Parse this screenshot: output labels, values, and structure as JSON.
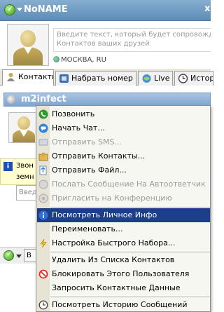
{
  "user": {
    "name": "NoNAME",
    "status_icon": "online-check-icon"
  },
  "profile": {
    "mood_placeholder": "Введите текст, который будет сопровождать",
    "mood_placeholder_line2": "Контактов ваших друзей",
    "location": "МОСКВА, RU"
  },
  "tabs": [
    {
      "label": "Контакты",
      "icon": "contacts-icon",
      "active": true
    },
    {
      "label": "Набрать номер",
      "icon": "dialpad-icon",
      "active": false
    },
    {
      "label": "Live",
      "icon": "live-icon",
      "active": false
    },
    {
      "label": "Истор",
      "icon": "history-icon",
      "active": false
    }
  ],
  "contact": {
    "name": "m2infect"
  },
  "notice": {
    "line1": "Звон",
    "line2": "земн"
  },
  "search": {
    "placeholder": "Введ"
  },
  "bottom": {
    "button_label": "В"
  },
  "menu": [
    {
      "label": "Позвонить",
      "icon": "phone-icon",
      "disabled": false
    },
    {
      "label": "Начать Чат...",
      "icon": "chat-icon",
      "disabled": false
    },
    {
      "label": "Отправить SMS...",
      "icon": "sms-icon",
      "disabled": true
    },
    {
      "label": "Отправить Контакты...",
      "icon": "send-contacts-icon",
      "disabled": false
    },
    {
      "label": "Отправить Файл...",
      "icon": "send-file-icon",
      "disabled": false
    },
    {
      "label": "Послать Сообщение На Автоответчик",
      "icon": "voicemail-icon",
      "disabled": true
    },
    {
      "label": "Пригласить на Конференцию",
      "icon": "conference-icon",
      "disabled": true
    },
    {
      "label": "Посмотреть Личное Инфо",
      "icon": "info-icon",
      "disabled": false,
      "selected": true
    },
    {
      "label": "Переименовать...",
      "icon": "",
      "disabled": false
    },
    {
      "label": "Настройка Быстрого Набора...",
      "icon": "speed-dial-icon",
      "disabled": false
    },
    {
      "label": "Удалить Из Списка Контактов",
      "icon": "",
      "disabled": false
    },
    {
      "label": "Блокировать Этого Пользователя",
      "icon": "block-icon",
      "disabled": false
    },
    {
      "label": "Запросить Контактные Данные",
      "icon": "",
      "disabled": false
    },
    {
      "label": "Посмотреть Историю Сообщений",
      "icon": "history-icon",
      "disabled": false
    }
  ],
  "colors": {
    "titlebar": "#5d8db8",
    "selection": "#1d3e8a",
    "contact_row": "#7fa5d0"
  }
}
